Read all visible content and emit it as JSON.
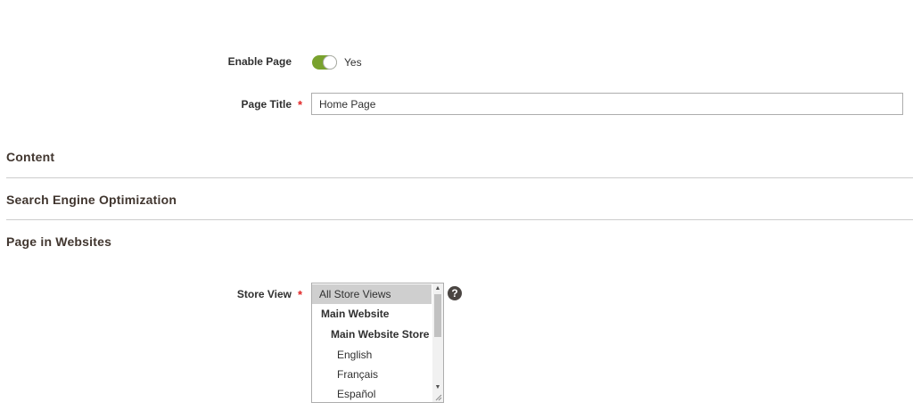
{
  "form": {
    "enable_page": {
      "label": "Enable Page",
      "value": true,
      "value_text": "Yes"
    },
    "page_title": {
      "label": "Page Title",
      "value": "Home Page",
      "required_mark": "*"
    }
  },
  "sections": [
    {
      "title": "Content"
    },
    {
      "title": "Search Engine Optimization"
    },
    {
      "title": "Page in Websites"
    }
  ],
  "store_view": {
    "label": "Store View",
    "required_mark": "*",
    "options": [
      {
        "label": "All Store Views",
        "selected": true,
        "bold": false
      },
      {
        "label": "Main Website",
        "selected": false,
        "bold": true
      },
      {
        "label": "Main Website Store",
        "selected": false,
        "bold": true
      },
      {
        "label": "English",
        "selected": false,
        "bold": false
      },
      {
        "label": "Français",
        "selected": false,
        "bold": false
      },
      {
        "label": "Español",
        "selected": false,
        "bold": false
      }
    ],
    "help_icon": "question-circle-icon",
    "help_glyph": "?"
  },
  "colors": {
    "toggle_on": "#79a22e",
    "required": "#e22626",
    "selected_option_bg": "#cfcfcf"
  }
}
